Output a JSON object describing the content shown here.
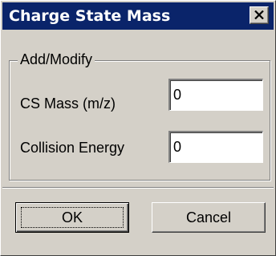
{
  "window": {
    "title": "Charge State Mass"
  },
  "group": {
    "title": "Add/Modify"
  },
  "fields": {
    "cs_mass": {
      "label": "CS Mass (m/z)",
      "value": "0"
    },
    "collision_energy": {
      "label": "Collision Energy",
      "value": "0"
    }
  },
  "buttons": {
    "ok": "OK",
    "cancel": "Cancel"
  },
  "icons": {
    "close": "close-icon"
  },
  "colors": {
    "titlebar": "#0a246a",
    "face": "#d4d0c8"
  }
}
